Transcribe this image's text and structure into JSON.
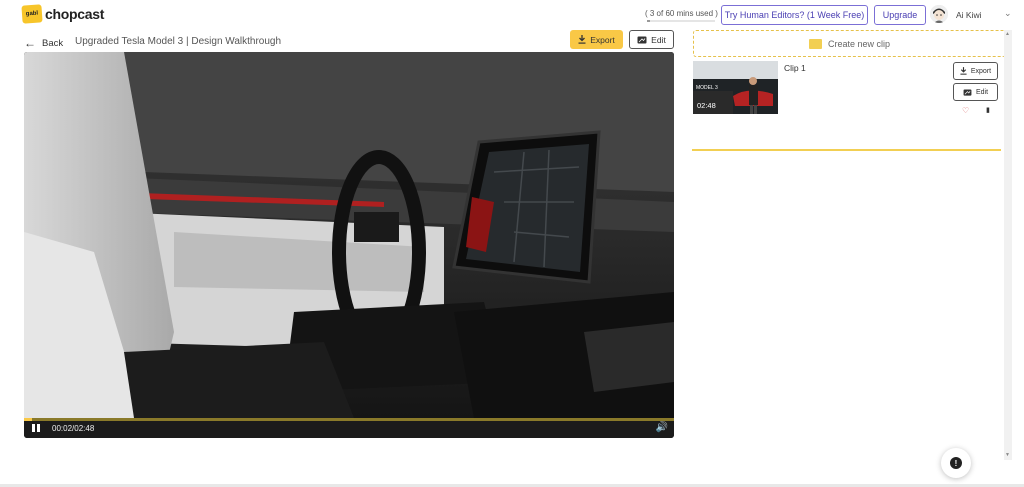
{
  "app": {
    "logo_text": "chopcast",
    "logo_mark_text": "gabl"
  },
  "header": {
    "usage_text": "( 3 of 60 mins used )",
    "usage_fraction": 0.05,
    "try_editors_label": "Try Human Editors? (1 Week Free)",
    "upgrade_label": "Upgrade",
    "user_name": "Ai Kiwi"
  },
  "toolbar": {
    "back_label": "Back",
    "video_title": "Upgraded Tesla Model 3 | Design Walkthrough",
    "export_label": "Export",
    "edit_label": "Edit"
  },
  "player": {
    "timecode": "00:02/02:48",
    "progress_fraction": 0.013
  },
  "clips_panel": {
    "create_label": "Create new clip",
    "clips": [
      {
        "title": "Clip 1",
        "duration": "02:48",
        "export_label": "Export",
        "edit_label": "Edit"
      }
    ]
  },
  "colors": {
    "accent": "#f9c846",
    "brand_purple": "#4a3fb3"
  }
}
